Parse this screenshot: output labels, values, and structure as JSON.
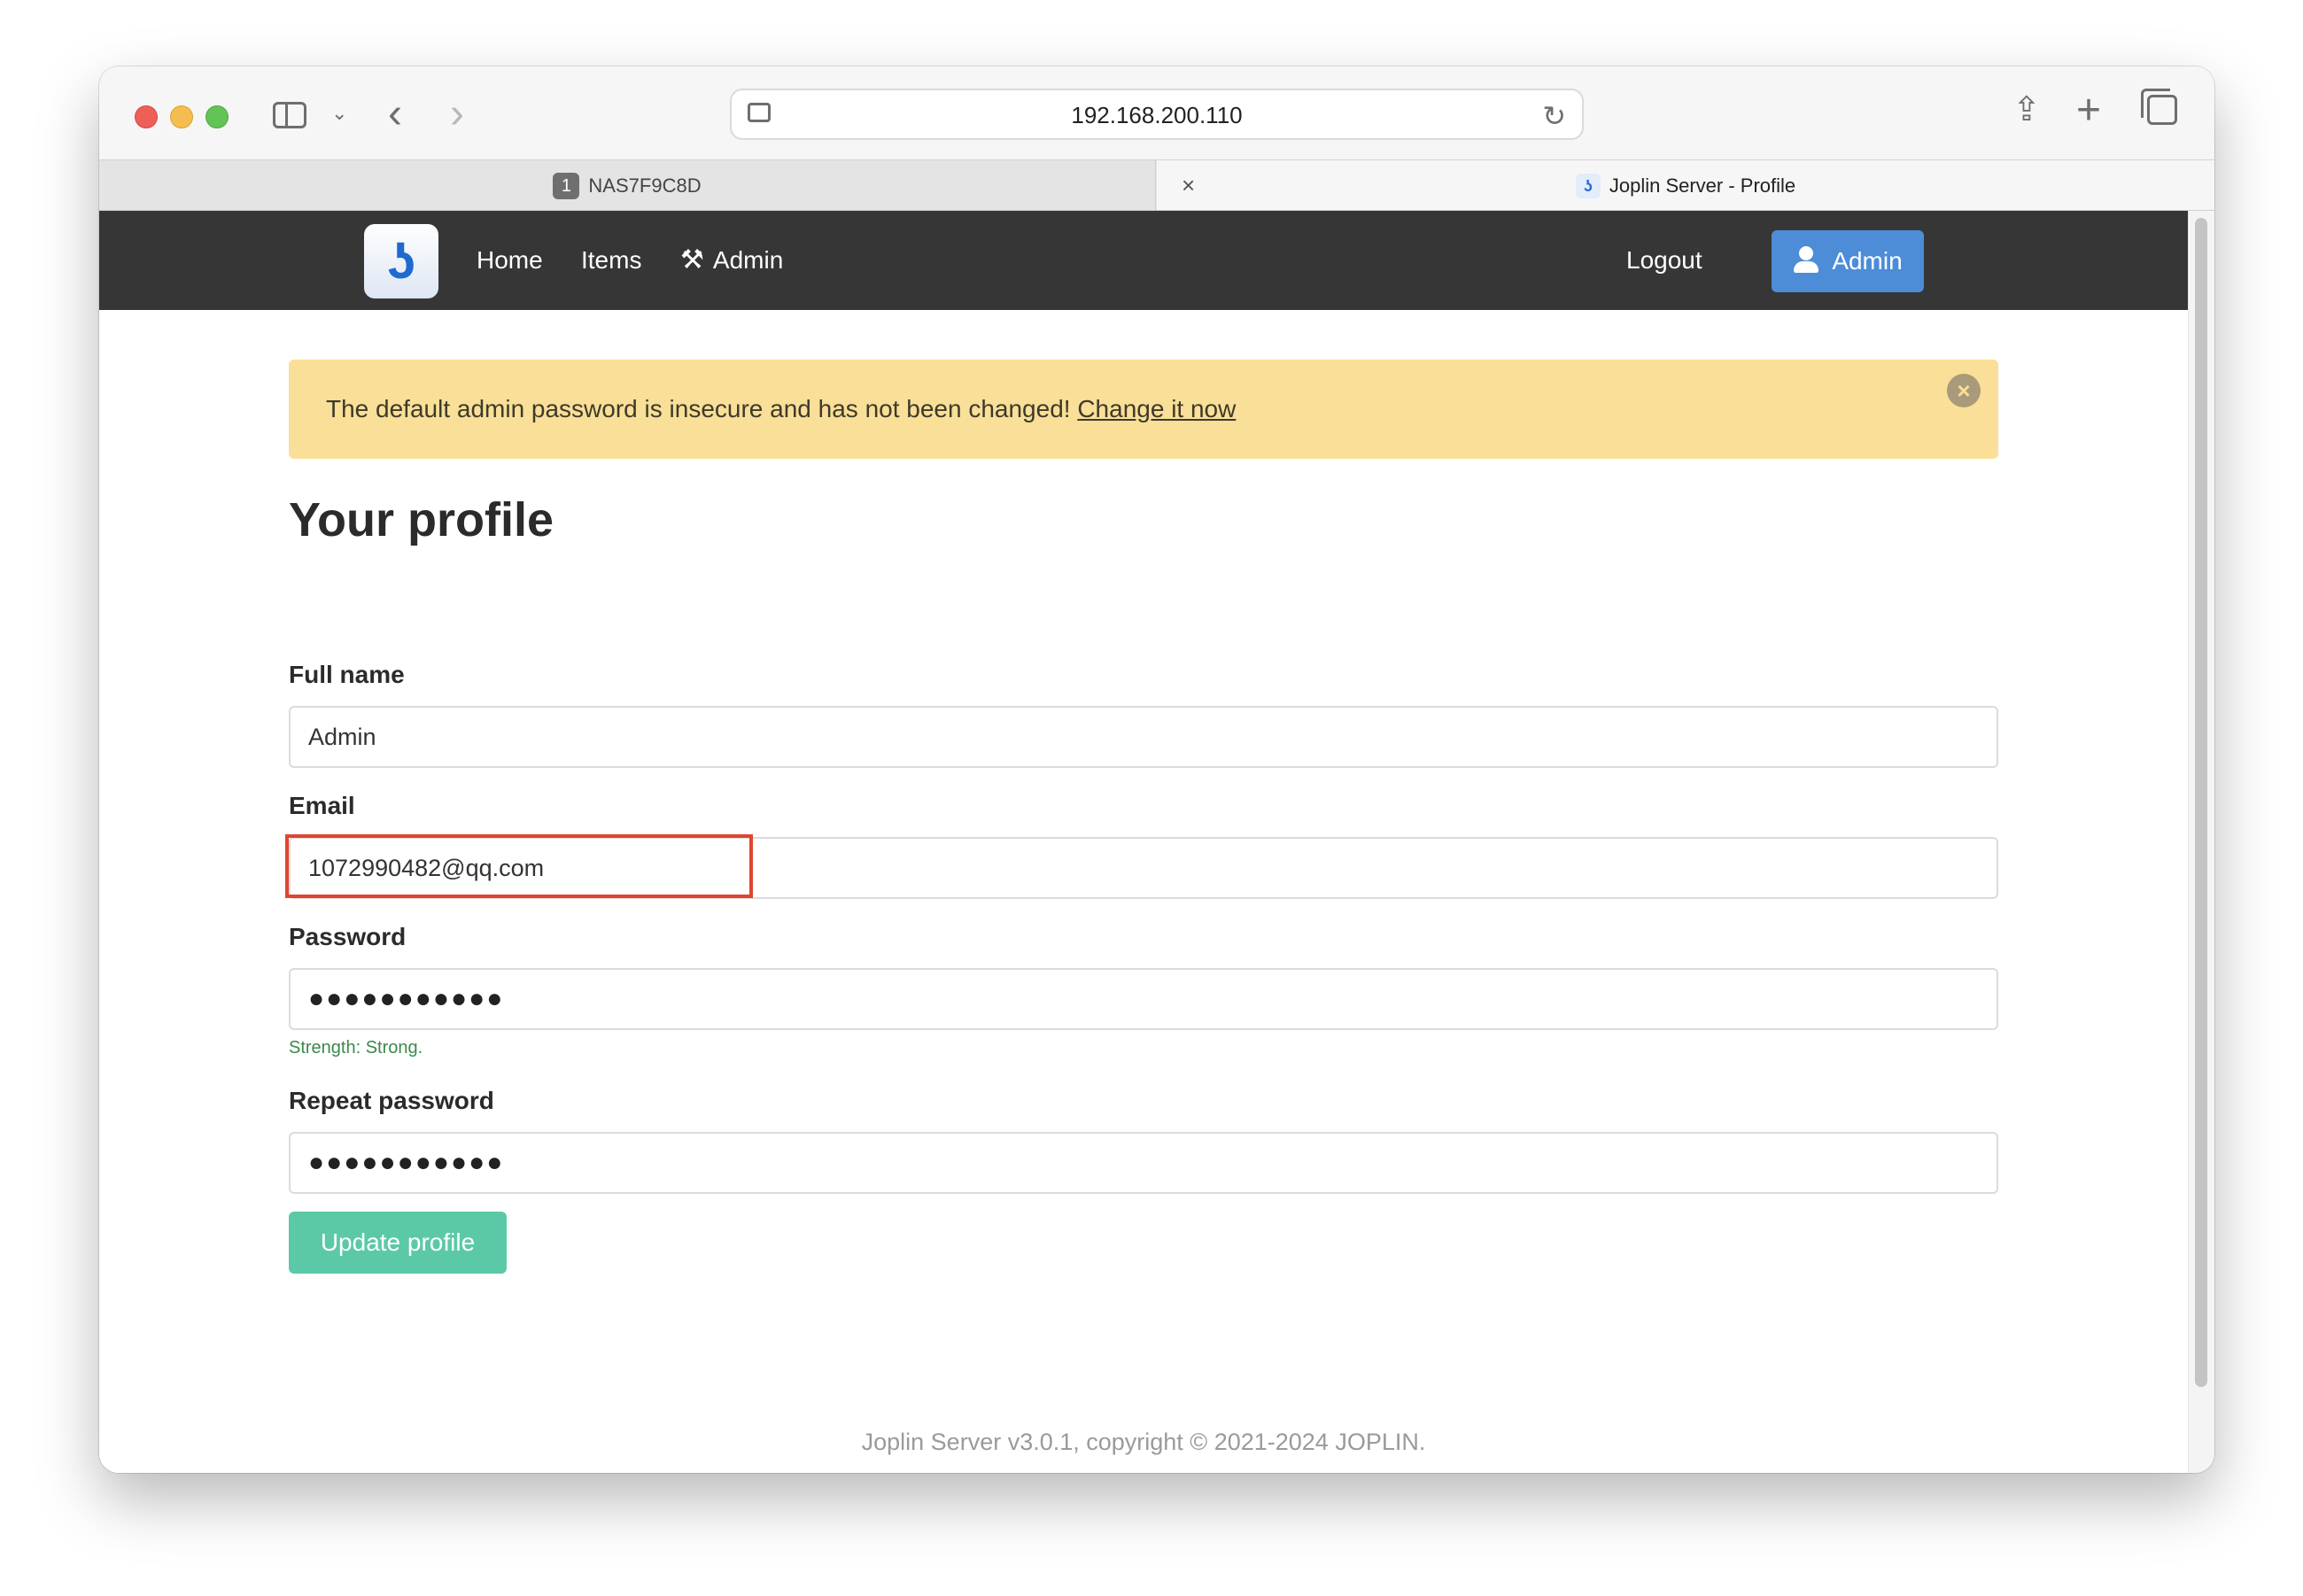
{
  "browser": {
    "address": "192.168.200.110",
    "tabs": [
      {
        "number": "1",
        "label": "NAS7F9C8D"
      },
      {
        "favicon": "joplin-icon",
        "label": "Joplin Server - Profile",
        "close": "×"
      }
    ],
    "icons": {
      "back": "‹",
      "forward": "›",
      "chevron": "⌄",
      "reload": "↻",
      "share": "⇪",
      "new_tab": "+"
    }
  },
  "navbar": {
    "logo": "ʖ",
    "links": [
      "Home",
      "Items",
      "Admin"
    ],
    "logout": "Logout",
    "user_button": "Admin",
    "colors": {
      "background": "#363636",
      "user_button": "#4d8dd8"
    }
  },
  "notice": {
    "text": "The default admin password is insecure and has not been changed! ",
    "link": "Change it now",
    "close": "×",
    "color": "#f9df97"
  },
  "form": {
    "title": "Your profile",
    "full_name": {
      "label": "Full name",
      "value": "Admin"
    },
    "email": {
      "label": "Email",
      "value": "1072990482@qq.com"
    },
    "password": {
      "label": "Password",
      "value": "●●●●●●●●●●●",
      "strength": "Strength: Strong."
    },
    "repeat_password": {
      "label": "Repeat password",
      "value": "●●●●●●●●●●●"
    },
    "submit": "Update profile",
    "submit_color": "#5bc9a8",
    "highlight_color": "#e0452f"
  },
  "footer": "Joplin Server v3.0.1, copyright © 2021-2024 JOPLIN."
}
